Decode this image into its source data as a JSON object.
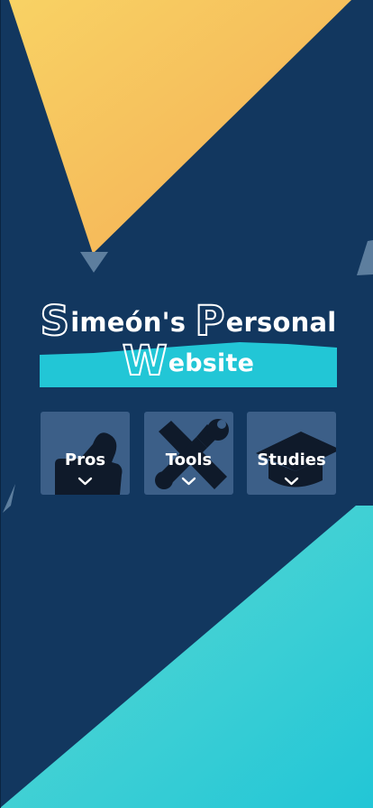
{
  "site": {
    "title_line1_cap1": "S",
    "title_line1_rest1": "imeón's ",
    "title_line1_cap2": "P",
    "title_line1_rest2": "ersonal",
    "title_line2_cap": "W",
    "title_line2_rest": "ebsite"
  },
  "cards": [
    {
      "label": "Pros",
      "icon": "thumbs-up-icon",
      "expand_icon": "chevron-down-icon"
    },
    {
      "label": "Tools",
      "icon": "tools-icon",
      "expand_icon": "chevron-down-icon"
    },
    {
      "label": "Studies",
      "icon": "graduation-cap-icon",
      "expand_icon": "chevron-down-icon"
    }
  ],
  "colors": {
    "background": "#12375f",
    "accent_yellow": "#f6c35a",
    "accent_cyan": "#22c6d6",
    "card_bg": "#3c5f88"
  }
}
